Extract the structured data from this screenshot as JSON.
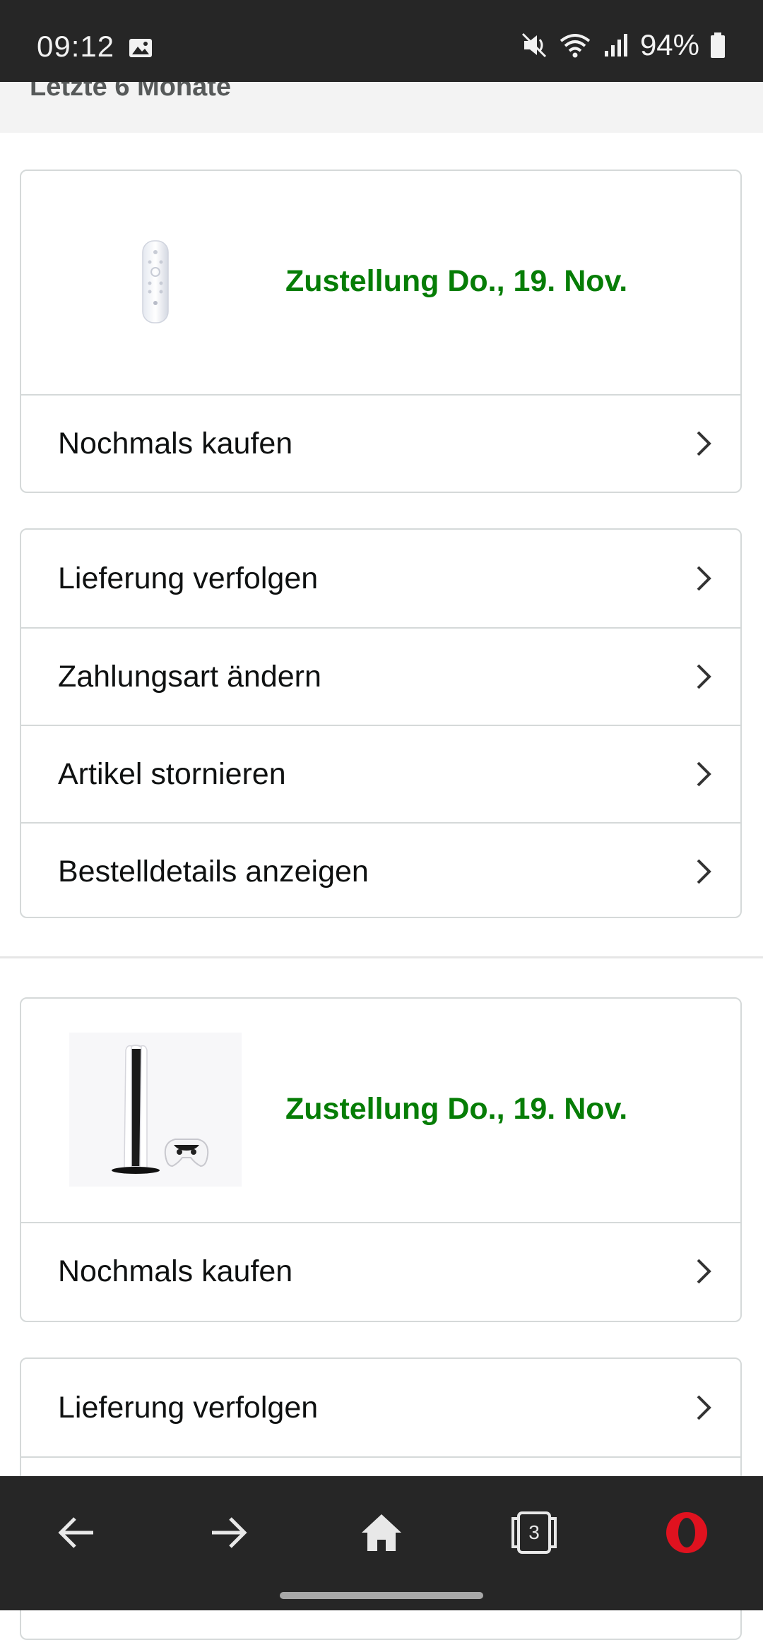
{
  "status_bar": {
    "time": "09:12",
    "battery": "94%",
    "icons": [
      "image-icon",
      "mute-icon",
      "wifi-icon",
      "signal-icon",
      "battery-icon"
    ]
  },
  "section": {
    "title": "Letzte 6 Monate"
  },
  "orders": [
    {
      "product_icon": "remote-control-image",
      "delivery": "Zustellung Do., 19. Nov.",
      "buy_again": "Nochmals kaufen",
      "actions": [
        "Lieferung verfolgen",
        "Zahlungsart ändern",
        "Artikel stornieren",
        "Bestelldetails anzeigen"
      ]
    },
    {
      "product_icon": "console-image",
      "delivery": "Zustellung Do., 19. Nov.",
      "buy_again": "Nochmals kaufen",
      "actions": [
        "Lieferung verfolgen"
      ]
    }
  ],
  "bottom_nav": {
    "tab_count": "3",
    "icons": [
      "back-arrow-icon",
      "forward-arrow-icon",
      "home-icon",
      "tabs-icon",
      "opera-icon"
    ]
  },
  "colors": {
    "delivery_green": "#067d06",
    "border": "#d5d9d9",
    "bar": "#262626",
    "opera_red": "#e0121f"
  }
}
